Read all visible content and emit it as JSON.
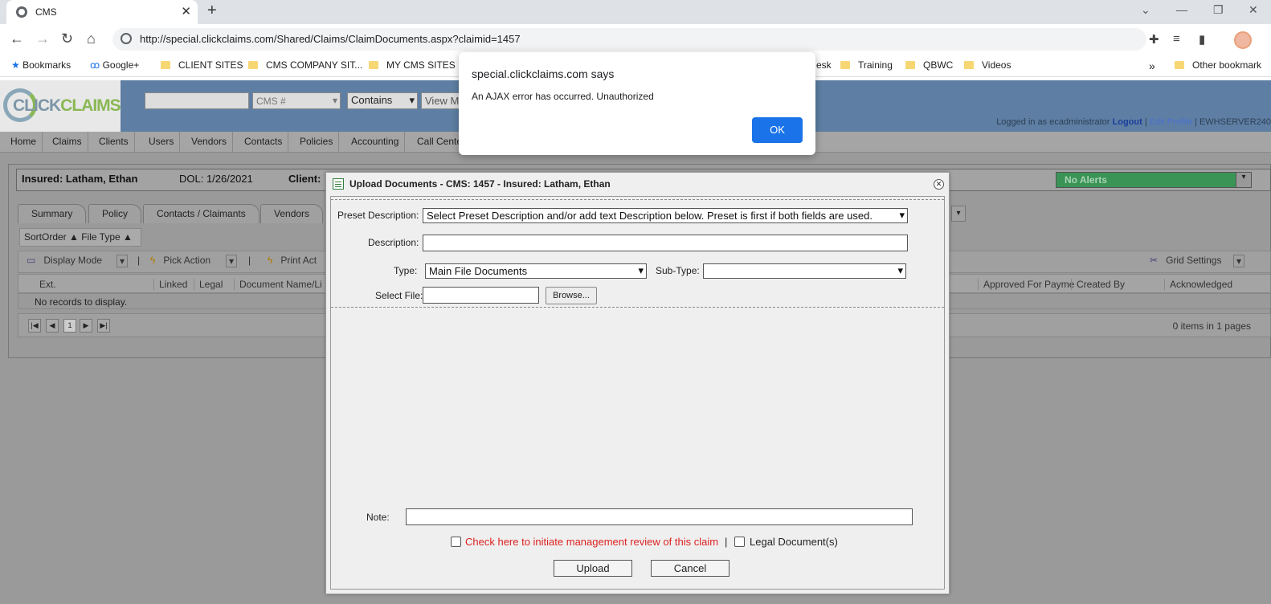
{
  "browser": {
    "tab_title": "CMS",
    "url": "http://special.clickclaims.com/Shared/Claims/ClaimDocuments.aspx?claimid=1457",
    "bookmarks": [
      "Bookmarks",
      "Google+",
      "CLIENT SITES",
      "CMS COMPANY SIT...",
      "MY CMS SITES",
      "esk",
      "Training",
      "QBWC",
      "Videos",
      "Other bookmark"
    ],
    "overflow": "»"
  },
  "app": {
    "logo_click": "CLICK",
    "logo_claims": "CLAIMS",
    "search_placeholder": "",
    "search_field": "CMS #",
    "search_op": "Contains",
    "view_btn": "View M",
    "login_prefix": "Logged in as ecadministrator",
    "logout": "Logout",
    "edit_profile": "Edit Profile",
    "server": "EWHSERVER240",
    "menu": [
      "Home",
      "Claims",
      "Clients",
      "Users",
      "Vendors",
      "Contacts",
      "Policies",
      "Accounting",
      "Call Cente"
    ],
    "insured": "Insured: Latham, Ethan",
    "dol": "DOL: 1/26/2021",
    "client": "Client:",
    "alerts": "No Alerts",
    "tabs": [
      "Summary",
      "Policy",
      "Contacts / Claimants",
      "Vendors"
    ],
    "sort": "SortOrder ▲ File Type ▲",
    "grid_toolbar": {
      "display_mode": "Display Mode",
      "pick_action": "Pick Action",
      "print": "Print Act",
      "grid_settings": "Grid Settings"
    },
    "grid_headers": [
      "Ext.",
      "Linked",
      "Legal",
      "Document Name/Li",
      "Approved For Payme",
      "Created By",
      "Acknowledged"
    ],
    "no_records": "No records to display.",
    "page": "1",
    "pager_info": "0 items in 1 pages"
  },
  "dialog": {
    "title": "Upload Documents - CMS: 1457 - Insured: Latham, Ethan",
    "preset_label": "Preset Description:",
    "preset_value": "Select Preset Description and/or add text Description below. Preset is first if both fields are used.",
    "description_label": "Description:",
    "type_label": "Type:",
    "type_value": "Main File Documents",
    "subtype_label": "Sub-Type:",
    "subtype_value": "",
    "file_label": "Select File:",
    "browse": "Browse...",
    "note_label": "Note:",
    "mgmt_review": "Check here to initiate management review of this claim",
    "separator": "|",
    "legal": "Legal Document(s)",
    "upload": "Upload",
    "cancel": "Cancel"
  },
  "alert": {
    "heading": "special.clickclaims.com says",
    "message": "An AJAX error has occurred. Unauthorized",
    "ok": "OK"
  }
}
